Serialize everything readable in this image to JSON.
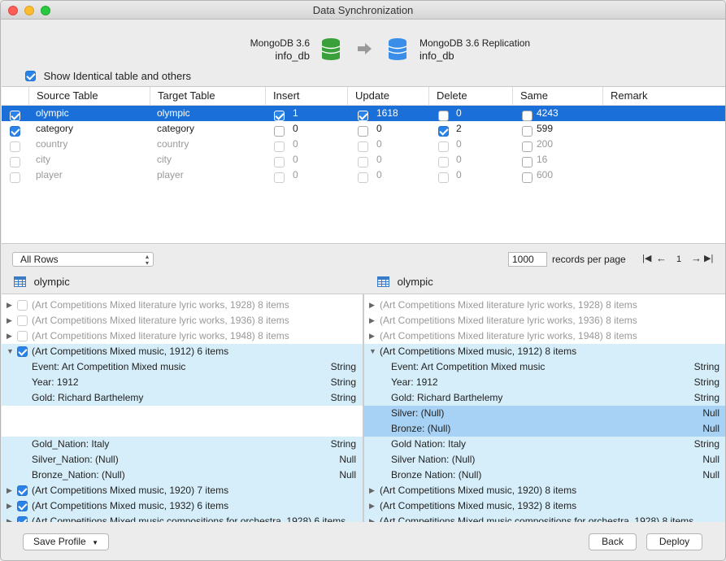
{
  "window": {
    "title": "Data Synchronization"
  },
  "header": {
    "source_db": "MongoDB 3.6",
    "source_name": "info_db",
    "target_db": "MongoDB 3.6 Replication",
    "target_name": "info_db",
    "show_identical_label": "Show Identical table and others",
    "show_identical_checked": true
  },
  "table": {
    "columns": [
      "Source Table",
      "Target Table",
      "Insert",
      "Update",
      "Delete",
      "Same",
      "Remark"
    ],
    "rows": [
      {
        "source": "olympic",
        "target": "olympic",
        "insert": "1",
        "update": "1618",
        "delete": "0",
        "same": "4243",
        "checked": true,
        "insert_chk": true,
        "update_chk": true,
        "delete_chk": false,
        "same_chk": false
      },
      {
        "source": "category",
        "target": "category",
        "insert": "0",
        "update": "0",
        "delete": "2",
        "same": "599",
        "checked": true,
        "insert_chk": false,
        "update_chk": false,
        "delete_chk": true,
        "same_chk": false
      },
      {
        "source": "country",
        "target": "country",
        "insert": "0",
        "update": "0",
        "delete": "0",
        "same": "200",
        "checked": false
      },
      {
        "source": "city",
        "target": "city",
        "insert": "0",
        "update": "0",
        "delete": "0",
        "same": "16",
        "checked": false
      },
      {
        "source": "player",
        "target": "player",
        "insert": "0",
        "update": "0",
        "delete": "0",
        "same": "600",
        "checked": false
      }
    ]
  },
  "controls": {
    "filter": "All Rows",
    "records_per_page": "1000",
    "records_label": "records per page",
    "page": "1"
  },
  "left_pane": {
    "title": "olympic",
    "rows": [
      {
        "text": "(Art Competitions Mixed literature lyric works, 1928) 8 items",
        "kind": "collapsed-dim"
      },
      {
        "text": "(Art Competitions Mixed literature lyric works, 1936) 8 items",
        "kind": "collapsed-dim"
      },
      {
        "text": "(Art Competitions Mixed literature lyric works, 1948) 8 items",
        "kind": "collapsed-dim"
      },
      {
        "text": "(Art Competitions Mixed music, 1912) 6 items",
        "kind": "expanded"
      },
      {
        "text": "Event: Art Competition Mixed music",
        "type": "String",
        "kind": "field"
      },
      {
        "text": "Year: 1912",
        "type": "String",
        "kind": "field"
      },
      {
        "text": "Gold: Richard Barthelemy",
        "type": "String",
        "kind": "field"
      },
      {
        "text": "",
        "kind": "empty"
      },
      {
        "text": "",
        "kind": "empty"
      },
      {
        "text": "Gold_Nation: Italy",
        "type": "String",
        "kind": "field"
      },
      {
        "text": "Silver_Nation: (Null)",
        "type": "Null",
        "kind": "field"
      },
      {
        "text": "Bronze_Nation: (Null)",
        "type": "Null",
        "kind": "field"
      },
      {
        "text": "(Art Competitions Mixed music, 1920) 7 items",
        "kind": "collapsed"
      },
      {
        "text": "(Art Competitions Mixed music, 1932) 6 items",
        "kind": "collapsed"
      },
      {
        "text": "(Art Competitions Mixed music compositions for orchestra, 1928) 6 items",
        "kind": "collapsed"
      }
    ]
  },
  "right_pane": {
    "title": "olympic",
    "rows": [
      {
        "text": "(Art Competitions Mixed literature lyric works, 1928) 8 items",
        "kind": "collapsed-dim"
      },
      {
        "text": "(Art Competitions Mixed literature lyric works, 1936) 8 items",
        "kind": "collapsed-dim"
      },
      {
        "text": "(Art Competitions Mixed literature lyric works, 1948) 8 items",
        "kind": "collapsed-dim"
      },
      {
        "text": "(Art Competitions Mixed music, 1912) 8 items",
        "kind": "expanded"
      },
      {
        "text": "Event: Art Competition Mixed music",
        "type": "String",
        "kind": "field"
      },
      {
        "text": "Year: 1912",
        "type": "String",
        "kind": "field"
      },
      {
        "text": "Gold: Richard Barthelemy",
        "type": "String",
        "kind": "field"
      },
      {
        "text": "Silver: (Null)",
        "type": "Null",
        "kind": "field-hi"
      },
      {
        "text": "Bronze: (Null)",
        "type": "Null",
        "kind": "field-hi"
      },
      {
        "text": "Gold Nation: Italy",
        "type": "String",
        "kind": "field"
      },
      {
        "text": "Silver Nation: (Null)",
        "type": "Null",
        "kind": "field"
      },
      {
        "text": "Bronze Nation: (Null)",
        "type": "Null",
        "kind": "field"
      },
      {
        "text": "(Art Competitions Mixed music, 1920) 8 items",
        "kind": "collapsed"
      },
      {
        "text": "(Art Competitions Mixed music, 1932) 8 items",
        "kind": "collapsed"
      },
      {
        "text": "(Art Competitions Mixed music compositions for orchestra, 1928) 8 items",
        "kind": "collapsed"
      }
    ]
  },
  "footer": {
    "save_profile": "Save Profile",
    "back": "Back",
    "deploy": "Deploy"
  },
  "colors": {
    "accent": "#1a6fd8",
    "row_blue": "#d6eefa",
    "row_highlight": "#a8d2f5",
    "source_db_icon": "#3aa13a",
    "target_db_icon": "#3a8ee8"
  }
}
